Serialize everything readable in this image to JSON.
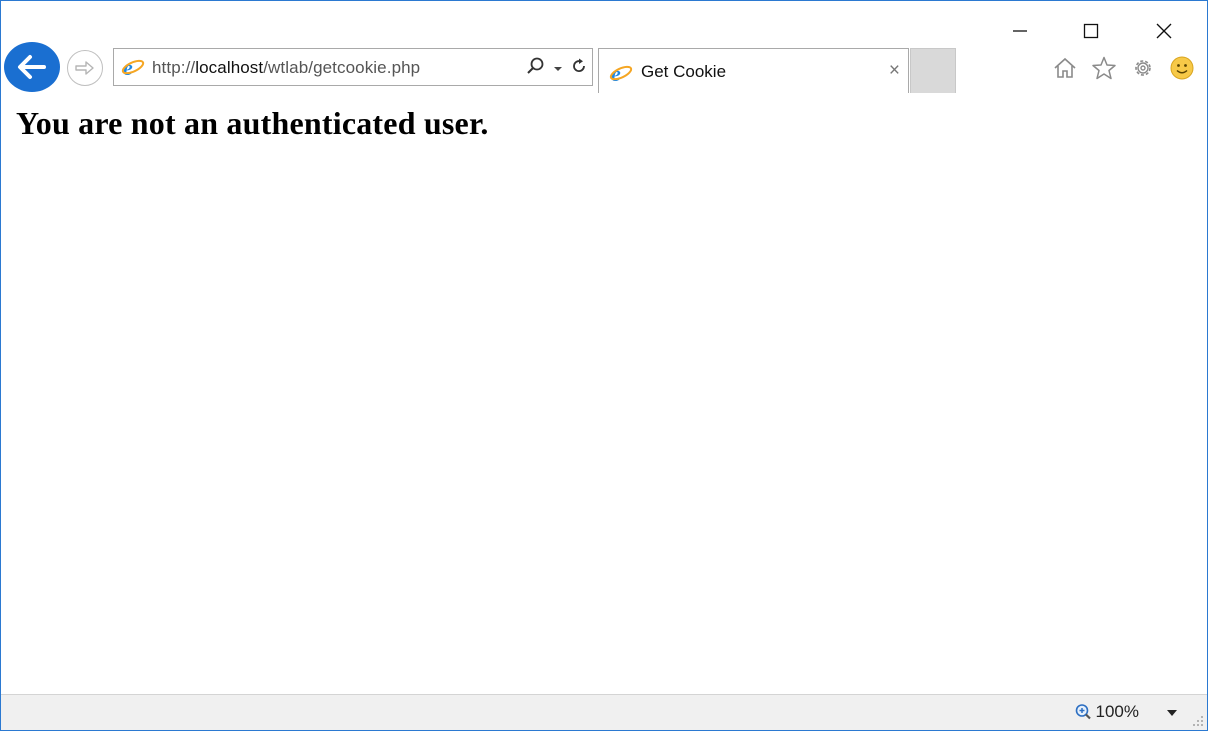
{
  "window": {
    "minimize_icon": "minimize-icon",
    "maximize_icon": "maximize-icon",
    "close_icon": "close-icon"
  },
  "nav": {
    "back_icon": "back-arrow-icon",
    "forward_icon": "forward-arrow-icon"
  },
  "address_bar": {
    "url_prefix": "http://",
    "url_host": "localhost",
    "url_path": "/wtlab/getcookie.php"
  },
  "tab": {
    "title": "Get Cookie",
    "close_label": "×"
  },
  "toolbar_icons": [
    "home-icon",
    "star-icon",
    "gear-icon",
    "smiley-icon"
  ],
  "page": {
    "heading": "You are not an authenticated user."
  },
  "status_bar": {
    "zoom": "100%"
  },
  "colors": {
    "accent": "#1a6fd1",
    "window_border": "#2b79d1",
    "ie_blue": "#1e88e5",
    "ie_gold": "#f5a623"
  }
}
